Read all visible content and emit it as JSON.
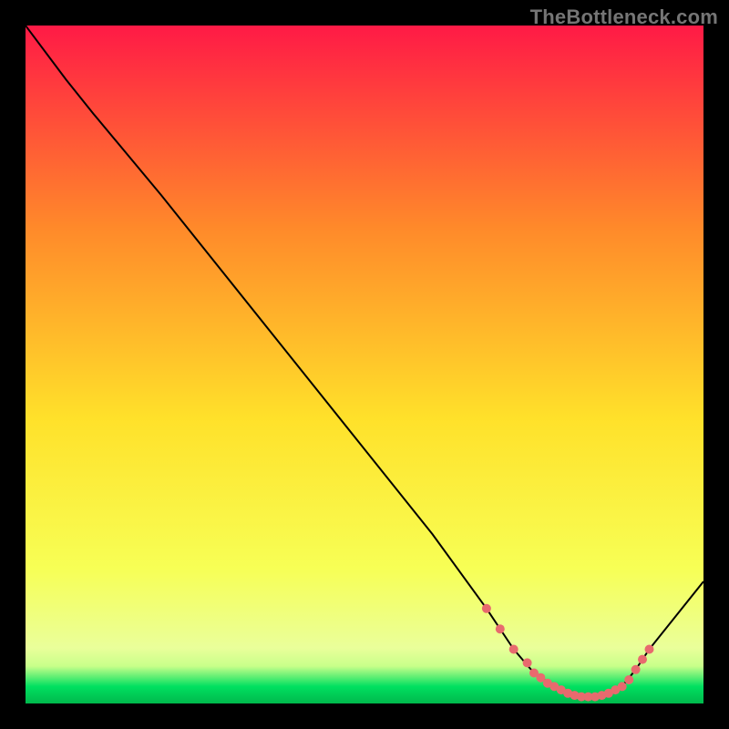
{
  "watermark": "TheBottleneck.com",
  "colors": {
    "background": "#000000",
    "watermark": "#757575",
    "grad_top": "#ff1a46",
    "grad_mid_upper": "#ff8a2a",
    "grad_mid": "#ffe12a",
    "grad_mid_lower": "#f7ff55",
    "grad_green1": "#c8ff8a",
    "grad_green2": "#00e060",
    "grad_bottom": "#00b84c",
    "line": "#000000",
    "marker": "#e86a6e"
  },
  "chart_data": {
    "type": "line",
    "title": "",
    "xlabel": "",
    "ylabel": "",
    "xlim": [
      0,
      100
    ],
    "ylim": [
      0,
      100
    ],
    "series": [
      {
        "name": "bottleneck-curve",
        "x": [
          0,
          6,
          10,
          20,
          30,
          40,
          50,
          60,
          68,
          72,
          75,
          78,
          80,
          82,
          84,
          86,
          88,
          90,
          92,
          100
        ],
        "y": [
          100,
          92,
          87,
          75,
          62.5,
          50,
          37.5,
          25,
          14,
          8,
          4.5,
          2.5,
          1.5,
          1,
          1,
          1.5,
          2.5,
          5,
          8,
          18
        ]
      }
    ],
    "markers": {
      "name": "highlight-points",
      "x": [
        68,
        70,
        72,
        74,
        75,
        76,
        77,
        78,
        79,
        80,
        81,
        82,
        83,
        84,
        85,
        86,
        87,
        88,
        89,
        90,
        91,
        92
      ],
      "y": [
        14,
        11,
        8,
        6,
        4.5,
        3.8,
        3,
        2.5,
        2,
        1.5,
        1.2,
        1,
        1,
        1,
        1.2,
        1.5,
        2,
        2.5,
        3.5,
        5,
        6.5,
        8
      ]
    }
  }
}
